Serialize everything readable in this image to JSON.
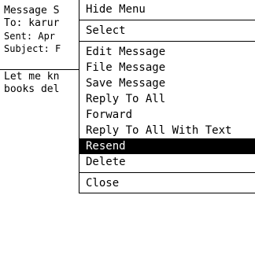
{
  "message": {
    "header_lines": [
      "Message S",
      "To: karur",
      "Sent: Apr",
      "Subject: F"
    ],
    "body_lines": [
      "Let me kn",
      "books del"
    ]
  },
  "menu": {
    "top_items": [
      "Hide Menu",
      "Select"
    ],
    "items": [
      "Edit Message",
      "File Message",
      "Save Message",
      "Reply To All",
      "Forward",
      "Reply To All With Text",
      "Resend",
      "Delete"
    ],
    "selected_item": "Resend",
    "bottom_items": [
      "Close"
    ]
  }
}
